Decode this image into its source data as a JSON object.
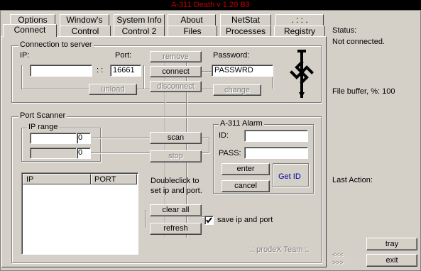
{
  "window": {
    "title": "A-311 Death v 1.20 B3"
  },
  "tabs": {
    "row_back": [
      "Options",
      "Window's",
      "System Info",
      "About",
      "NetStat",
      ". : : ."
    ],
    "row_front": [
      "Connect",
      "Control",
      "Control 2",
      "Files",
      "Processes",
      "Registry"
    ],
    "active": "Connect"
  },
  "connection": {
    "group_title": "Connection to server",
    "ip_label": "IP:",
    "ip_value": "",
    "separator": ": :",
    "port_label": "Port:",
    "port_value": "16661",
    "password_label": "Password:",
    "password_value": "PASSWRD",
    "remove_label": "remove",
    "connect_label": "connect",
    "unload_label": "unload",
    "disconnect_label": "disconnect",
    "change_label": "change"
  },
  "scanner": {
    "group_title": "Port Scanner",
    "ip_range_title": "IP range",
    "range_start_value": "",
    "range_start_suffix": "0",
    "range_end_value": "",
    "range_end_suffix": "0",
    "scan_label": "scan",
    "stop_label": "stop",
    "columns": [
      "IP",
      "PORT"
    ],
    "hint": "Doubleclick to set ip and port.",
    "clear_all_label": "clear all",
    "refresh_label": "refresh",
    "save_checkbox_label": "save ip and port",
    "save_checked": true,
    "credit": ".: prodeX Team :."
  },
  "alarm": {
    "group_title": "A-311 Alarm",
    "id_label": "ID:",
    "id_value": "",
    "pass_label": "PASS:",
    "pass_value": "",
    "enter_label": "enter",
    "cancel_label": "cancel",
    "get_id_label": "Get ID",
    "get_id_color": "#0000a0"
  },
  "status_panel": {
    "status_label": "Status:",
    "status_value": "Not connected.",
    "file_buffer_label": "File buffer, %: 100",
    "last_action_label": "Last Action:",
    "arrows_up": "<<<",
    "arrows_down": ">>>",
    "tray_label": "tray",
    "exit_label": "exit"
  },
  "colors": {
    "title_text": "#c00000",
    "titlebar_bg": "#000000",
    "face": "#d4d0c8"
  },
  "icons": {
    "logo": "cross-sword-logo-icon",
    "check": "checkmark-icon"
  }
}
